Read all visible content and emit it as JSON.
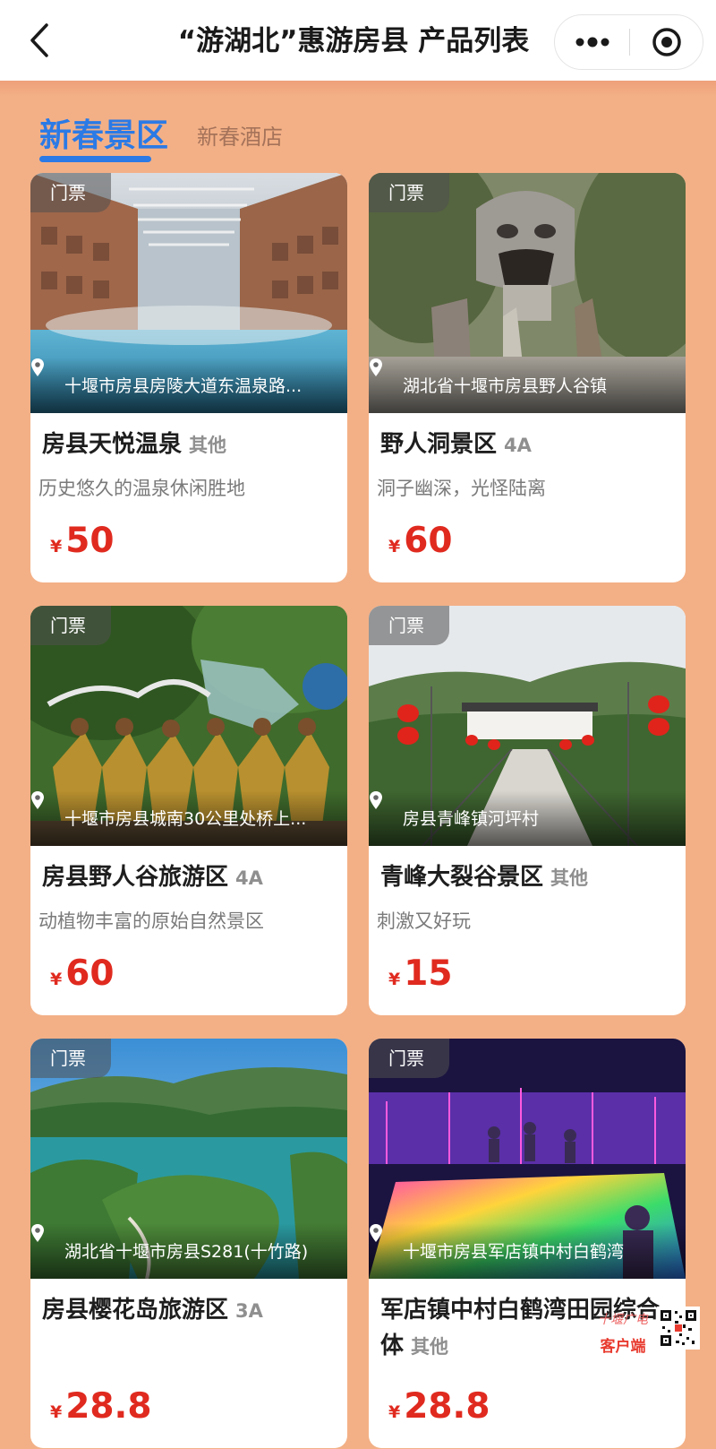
{
  "nav": {
    "title": "“游湖北”惠游房县 产品列表"
  },
  "tabs": {
    "active": "新春景区",
    "inactive": "新春酒店"
  },
  "accent": "#2b7ae6",
  "price_color": "#e02a1f",
  "background": "#f3b086",
  "cards": [
    {
      "tag": "门票",
      "location": "十堰市房县房陵大道东温泉路...",
      "name": "房县天悦温泉",
      "level": "其他",
      "desc": "历史悠久的温泉休闲胜地",
      "yen": "¥",
      "price": "50"
    },
    {
      "tag": "门票",
      "location": "湖北省十堰市房县野人谷镇",
      "name": "野人洞景区",
      "level": "4A",
      "desc": "洞子幽深，光怪陆离",
      "yen": "¥",
      "price": "60"
    },
    {
      "tag": "门票",
      "location": "十堰市房县城南30公里处桥上...",
      "name": "房县野人谷旅游区",
      "level": "4A",
      "desc": "动植物丰富的原始自然景区",
      "yen": "¥",
      "price": "60"
    },
    {
      "tag": "门票",
      "location": "房县青峰镇河坪村",
      "name": "青峰大裂谷景区",
      "level": "其他",
      "desc": "刺激又好玩",
      "yen": "¥",
      "price": "15"
    },
    {
      "tag": "门票",
      "location": "湖北省十堰市房县S281(十竹路)",
      "name": "房县樱花岛旅游区",
      "level": "3A",
      "desc": "",
      "yen": "¥",
      "price": "28.8"
    },
    {
      "tag": "门票",
      "location": "十堰市房县军店镇中村白鹤湾",
      "name": "军店镇中村白鹤湾田园综合体",
      "level": "其他",
      "desc": "",
      "yen": "¥",
      "price": "28.8"
    }
  ],
  "watermark": {
    "brand": "十堰广电",
    "label": "客户端"
  },
  "icons": {
    "back": "chevron-left-icon",
    "more": "more-dots-icon",
    "close": "target-close-icon",
    "pin": "location-pin-icon"
  }
}
